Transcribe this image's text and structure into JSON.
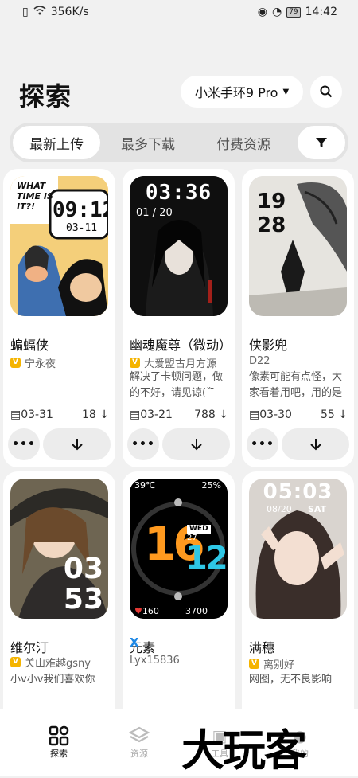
{
  "status": {
    "speed": "356K/s",
    "battery": "79",
    "time": "14:42"
  },
  "header": {
    "title": "探索",
    "device": "小米手环9 Pro"
  },
  "tabs": [
    {
      "label": "最新上传"
    },
    {
      "label": "最多下载"
    },
    {
      "label": "付费资源"
    }
  ],
  "cards": [
    {
      "name": "蝙蝠侠",
      "author": "宁永夜",
      "badge": "v",
      "desc": "",
      "date": "03-31",
      "downloads": "18",
      "face": {
        "top": "WHAT TIME IS IT?!",
        "time": "09:12",
        "date": "03-11"
      }
    },
    {
      "name": "幽魂魔尊（微动）",
      "author": "大爱盟古月方源",
      "badge": "v",
      "desc": "解决了卡顿问题，做的不好，请见谅(ˇ ̄",
      "date": "03-21",
      "downloads": "788",
      "face": {
        "time": "03:36",
        "date": "01 / 20"
      }
    },
    {
      "name": "侠影兜",
      "author": "D22",
      "badge": "",
      "desc": "像素可能有点怪，大家看着用吧，用的是",
      "date": "03-30",
      "downloads": "55",
      "face": {
        "hour": "19",
        "minute": "28"
      }
    },
    {
      "name": "维尔汀",
      "author": "关山难越gsny",
      "badge": "v",
      "desc": "小v小v我们喜欢你",
      "date": "",
      "downloads": "",
      "face": {
        "hour": "03",
        "minute": "53"
      }
    },
    {
      "name": "元素",
      "author": "Lyx15836",
      "badge": "x",
      "desc": "",
      "date": "",
      "downloads": "",
      "face": {
        "temp": "39℃",
        "battery": "25%",
        "hour": "16",
        "minute": "12",
        "day": "WED",
        "daynum": "27",
        "steps": "160",
        "calories": "3700"
      }
    },
    {
      "name": "满穗",
      "author": "离别好",
      "badge": "v",
      "desc": "网图，无不良影响",
      "date": "",
      "downloads": "",
      "face": {
        "time": "05:03",
        "date": "08/20",
        "day": "SAT"
      }
    }
  ],
  "nav": [
    {
      "label": "探索"
    },
    {
      "label": "资源"
    },
    {
      "label": "工具"
    },
    {
      "label": "我的"
    }
  ],
  "watermark": "大玩客",
  "colors": {
    "accent": "#f5b400",
    "background": "#f1f1f1"
  }
}
